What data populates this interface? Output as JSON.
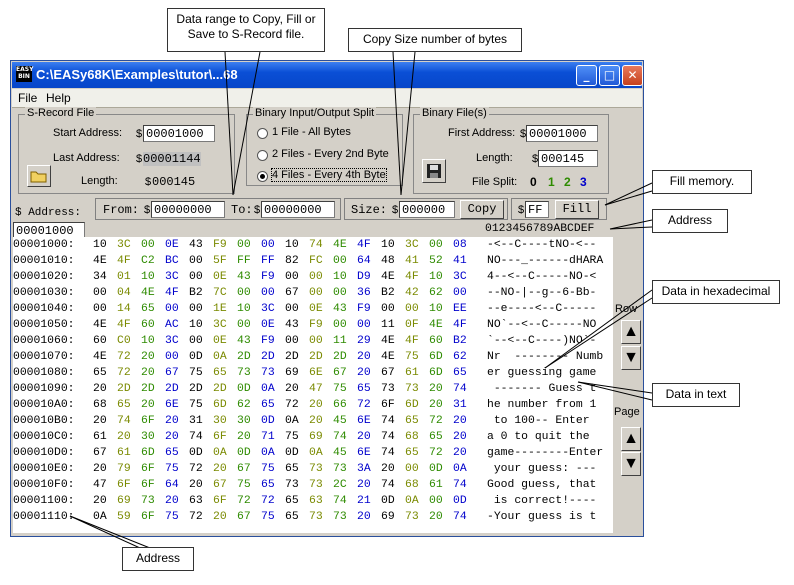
{
  "window": {
    "title": "C:\\EASy68K\\Examples\\tutor\\...68",
    "app_icon_text": "EASY BIN",
    "minimize": "_",
    "maximize": "□",
    "close": "✕"
  },
  "menu": {
    "file": "File",
    "help": "Help"
  },
  "srecord": {
    "group_label": "S-Record File",
    "start_label": "Start Address:",
    "start_value": "00001000",
    "last_label": "Last Address:",
    "last_value": "00001144",
    "length_label": "Length:",
    "length_value": "000145",
    "dollar": "$"
  },
  "split": {
    "group_label": "Binary Input/Output Split",
    "opt1": "1 File - All Bytes",
    "opt2": "2 Files - Every 2nd Byte",
    "opt3": "4 Files - Every 4th Byte",
    "selected": 3
  },
  "binfiles": {
    "group_label": "Binary File(s)",
    "first_label": "First Address:",
    "first_value": "00001000",
    "length_label": "Length:",
    "length_value": "000145",
    "filesplit_label": "File Split:",
    "split_nums": [
      "0",
      "1",
      "2",
      "3"
    ],
    "split_colors": [
      "#000000",
      "#2e8b00",
      "#2e8b00",
      "#0000cc"
    ]
  },
  "toolbar": {
    "address_label": "$ Address:",
    "address_value": "00001000",
    "from_label": "From:",
    "from_value": "00000000",
    "to_label": "To:",
    "to_value": "00000000",
    "size_label": "Size:",
    "size_value": "000000",
    "copy_label": "Copy",
    "fill_value": "FF",
    "fill_label": "Fill"
  },
  "hex": {
    "header_cols": [
      "00",
      "01",
      "02",
      "03",
      "04",
      "05",
      "06",
      "07",
      "08",
      "09",
      "0A",
      "0B",
      "0C",
      "0D",
      "0E",
      "0F"
    ],
    "header_text": "0123456789ABCDEF",
    "byte_colors": [
      "#000000",
      "#7a8a00",
      "#2e8b00",
      "#0000cc"
    ],
    "rows": [
      {
        "addr": "00001000:",
        "bytes": [
          "10",
          "3C",
          "00",
          "0E",
          "43",
          "F9",
          "00",
          "00",
          "10",
          "74",
          "4E",
          "4F",
          "10",
          "3C",
          "00",
          "08"
        ],
        "text": "-<--C----tNO-<--"
      },
      {
        "addr": "00001010:",
        "bytes": [
          "4E",
          "4F",
          "C2",
          "BC",
          "00",
          "5F",
          "FF",
          "FF",
          "82",
          "FC",
          "00",
          "64",
          "48",
          "41",
          "52",
          "41"
        ],
        "text": "NO---_------dHARA"
      },
      {
        "addr": "00001020:",
        "bytes": [
          "34",
          "01",
          "10",
          "3C",
          "00",
          "0E",
          "43",
          "F9",
          "00",
          "00",
          "10",
          "D9",
          "4E",
          "4F",
          "10",
          "3C"
        ],
        "text": "4--<--C-----NO-<"
      },
      {
        "addr": "00001030:",
        "bytes": [
          "00",
          "04",
          "4E",
          "4F",
          "B2",
          "7C",
          "00",
          "00",
          "67",
          "00",
          "00",
          "36",
          "B2",
          "42",
          "62",
          "00"
        ],
        "text": "--NO-|--g--6-Bb-"
      },
      {
        "addr": "00001040:",
        "bytes": [
          "00",
          "14",
          "65",
          "00",
          "00",
          "1E",
          "10",
          "3C",
          "00",
          "0E",
          "43",
          "F9",
          "00",
          "00",
          "10",
          "EE"
        ],
        "text": "--e----<--C-----"
      },
      {
        "addr": "00001050:",
        "bytes": [
          "4E",
          "4F",
          "60",
          "AC",
          "10",
          "3C",
          "00",
          "0E",
          "43",
          "F9",
          "00",
          "00",
          "11",
          "0F",
          "4E",
          "4F"
        ],
        "text": "NO`--<--C-----NO"
      },
      {
        "addr": "00001060:",
        "bytes": [
          "60",
          "C0",
          "10",
          "3C",
          "00",
          "0E",
          "43",
          "F9",
          "00",
          "00",
          "11",
          "29",
          "4E",
          "4F",
          "60",
          "B2"
        ],
        "text": "`--<--C----)NO`-"
      },
      {
        "addr": "00001070:",
        "bytes": [
          "4E",
          "72",
          "20",
          "00",
          "0D",
          "0A",
          "2D",
          "2D",
          "2D",
          "2D",
          "2D",
          "20",
          "4E",
          "75",
          "6D",
          "62"
        ],
        "text": "Nr  -------- Numb"
      },
      {
        "addr": "00001080:",
        "bytes": [
          "65",
          "72",
          "20",
          "67",
          "75",
          "65",
          "73",
          "73",
          "69",
          "6E",
          "67",
          "20",
          "67",
          "61",
          "6D",
          "65"
        ],
        "text": "er guessing game"
      },
      {
        "addr": "00001090:",
        "bytes": [
          "20",
          "2D",
          "2D",
          "2D",
          "2D",
          "2D",
          "0D",
          "0A",
          "20",
          "47",
          "75",
          "65",
          "73",
          "73",
          "20",
          "74"
        ],
        "text": " ------- Guess t"
      },
      {
        "addr": "000010A0:",
        "bytes": [
          "68",
          "65",
          "20",
          "6E",
          "75",
          "6D",
          "62",
          "65",
          "72",
          "20",
          "66",
          "72",
          "6F",
          "6D",
          "20",
          "31"
        ],
        "text": "he number from 1"
      },
      {
        "addr": "000010B0:",
        "bytes": [
          "20",
          "74",
          "6F",
          "20",
          "31",
          "30",
          "30",
          "0D",
          "0A",
          "20",
          "45",
          "6E",
          "74",
          "65",
          "72",
          "20"
        ],
        "text": " to 100-- Enter "
      },
      {
        "addr": "000010C0:",
        "bytes": [
          "61",
          "20",
          "30",
          "20",
          "74",
          "6F",
          "20",
          "71",
          "75",
          "69",
          "74",
          "20",
          "74",
          "68",
          "65",
          "20"
        ],
        "text": "a 0 to quit the "
      },
      {
        "addr": "000010D0:",
        "bytes": [
          "67",
          "61",
          "6D",
          "65",
          "0D",
          "0A",
          "0D",
          "0A",
          "0D",
          "0A",
          "45",
          "6E",
          "74",
          "65",
          "72",
          "20"
        ],
        "text": "game--------Enter "
      },
      {
        "addr": "000010E0:",
        "bytes": [
          "20",
          "79",
          "6F",
          "75",
          "72",
          "20",
          "67",
          "75",
          "65",
          "73",
          "73",
          "3A",
          "20",
          "00",
          "0D",
          "0A"
        ],
        "text": " your guess: ---"
      },
      {
        "addr": "000010F0:",
        "bytes": [
          "47",
          "6F",
          "6F",
          "64",
          "20",
          "67",
          "75",
          "65",
          "73",
          "73",
          "2C",
          "20",
          "74",
          "68",
          "61",
          "74"
        ],
        "text": "Good guess, that"
      },
      {
        "addr": "00001100:",
        "bytes": [
          "20",
          "69",
          "73",
          "20",
          "63",
          "6F",
          "72",
          "72",
          "65",
          "63",
          "74",
          "21",
          "0D",
          "0A",
          "00",
          "0D"
        ],
        "text": " is correct!----"
      },
      {
        "addr": "00001110:",
        "bytes": [
          "0A",
          "59",
          "6F",
          "75",
          "72",
          "20",
          "67",
          "75",
          "65",
          "73",
          "73",
          "20",
          "69",
          "73",
          "20",
          "74"
        ],
        "text": "-Your guess is t"
      }
    ]
  },
  "side": {
    "row_label": "Row",
    "page_label": "Page",
    "up": "▲",
    "down": "▼"
  },
  "callouts": {
    "data_range": "Data range to Copy, Fill or Save to S-Record file.",
    "copy_size": "Copy Size number of bytes",
    "fill_memory": "Fill memory.",
    "address_top": "Address",
    "data_hex": "Data in hexadecimal",
    "data_text": "Data in text",
    "address_bottom": "Address"
  }
}
